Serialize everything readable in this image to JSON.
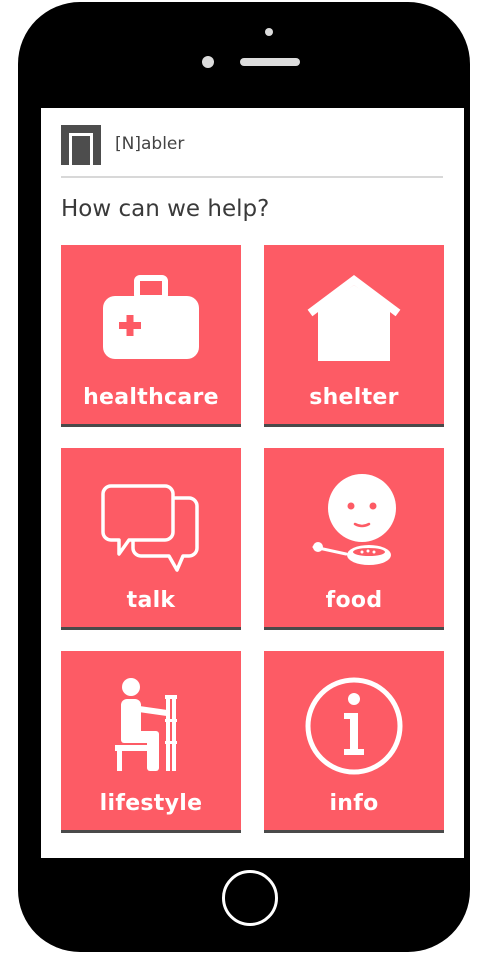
{
  "app": {
    "name": "[N]abler",
    "logo_icon": "door-logo-icon"
  },
  "prompt": "How can we help?",
  "tiles": [
    {
      "label": "healthcare",
      "icon": "medical-kit-icon"
    },
    {
      "label": "shelter",
      "icon": "house-icon"
    },
    {
      "label": "talk",
      "icon": "chat-bubbles-icon"
    },
    {
      "label": "food",
      "icon": "face-spoon-icon"
    },
    {
      "label": "lifestyle",
      "icon": "person-crutch-icon"
    },
    {
      "label": "info",
      "icon": "info-icon"
    }
  ],
  "colors": {
    "tile": "#fd5b65",
    "tile_shadow": "#4a4a4a",
    "device": "#000000"
  }
}
